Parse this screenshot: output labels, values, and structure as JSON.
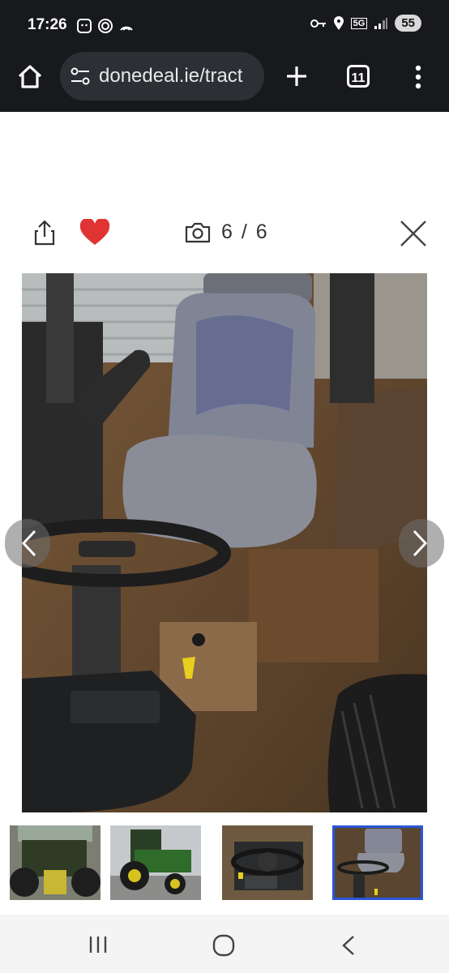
{
  "status_bar": {
    "time": "17:26",
    "battery": "55",
    "network": "5G",
    "left_icons": [
      "face-scan-icon",
      "fingerprint-icon",
      "hotspot-icon"
    ],
    "right_icons": [
      "key-icon",
      "location-icon",
      "network-5g-icon",
      "signal-icon"
    ]
  },
  "browser": {
    "url": "donedeal.ie/tract",
    "tab_count": "11",
    "icons": [
      "home-icon",
      "site-settings-icon",
      "plus-icon",
      "tabs-icon",
      "more-vert-icon"
    ]
  },
  "gallery": {
    "counter": "6 / 6",
    "current_index": 6,
    "total": 6,
    "heart_color": "#e03434",
    "icons": [
      "share-icon",
      "heart-icon",
      "camera-icon",
      "close-icon",
      "chevron-left-icon",
      "chevron-right-icon"
    ]
  },
  "thumbnails": [
    {
      "subject": "tractor-rear",
      "active": false
    },
    {
      "subject": "tractor-side",
      "active": false
    },
    {
      "subject": "steering-wheel",
      "active": false
    },
    {
      "subject": "tractor-seat",
      "active": true
    }
  ],
  "colors": {
    "accent_border": "#2a57d6",
    "toolbar_bg": "#17191c"
  }
}
